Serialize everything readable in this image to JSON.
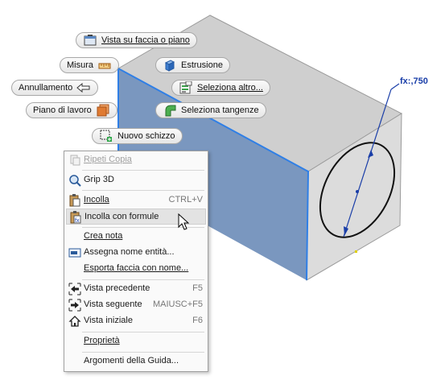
{
  "marking_menu": {
    "view_face": "Vista su faccia o piano",
    "measure": "Misura",
    "extrude": "Estrusione",
    "undo": "Annullamento",
    "select_other": "Seleziona altro...",
    "work_plane": "Piano di lavoro",
    "select_tangent": "Seleziona tangenze",
    "new_sketch": "Nuovo schizzo"
  },
  "dimension_label": "fx:,750",
  "context_menu": {
    "items": [
      {
        "label": "Ripeti Copia",
        "shortcut": "",
        "icon": "repeat-copy-icon",
        "disabled": true
      },
      {
        "label": "Grip 3D",
        "shortcut": "",
        "icon": "grip-3d-icon",
        "disabled": false
      },
      {
        "label": "Incolla",
        "shortcut": "CTRL+V",
        "icon": "paste-icon",
        "disabled": false
      },
      {
        "label": "Incolla con formule",
        "shortcut": "",
        "icon": "paste-formulas-icon",
        "disabled": false,
        "hover": true
      },
      {
        "label": "Crea nota",
        "shortcut": "",
        "icon": "",
        "disabled": false
      },
      {
        "label": "Assegna nome entità...",
        "shortcut": "",
        "icon": "assign-name-icon",
        "disabled": false
      },
      {
        "label": "Esporta faccia con nome...",
        "shortcut": "",
        "icon": "",
        "disabled": false
      },
      {
        "label": "Vista precedente",
        "shortcut": "F5",
        "icon": "previous-view-icon",
        "disabled": false
      },
      {
        "label": "Vista seguente",
        "shortcut": "MAIUSC+F5",
        "icon": "next-view-icon",
        "disabled": false
      },
      {
        "label": "Vista iniziale",
        "shortcut": "F6",
        "icon": "home-view-icon",
        "disabled": false
      },
      {
        "label": "Proprietà",
        "shortcut": "",
        "icon": "",
        "disabled": false
      },
      {
        "label": "Argomenti della Guida...",
        "shortcut": "",
        "icon": "",
        "disabled": false
      }
    ]
  },
  "colors": {
    "selected_face": "#7a97bf",
    "selection_edge": "#2f7fe6",
    "top_face": "#cfcfcf",
    "front_face": "#dcdcdc",
    "dimension": "#1a3ea8",
    "hover": "#e3e3e3"
  }
}
